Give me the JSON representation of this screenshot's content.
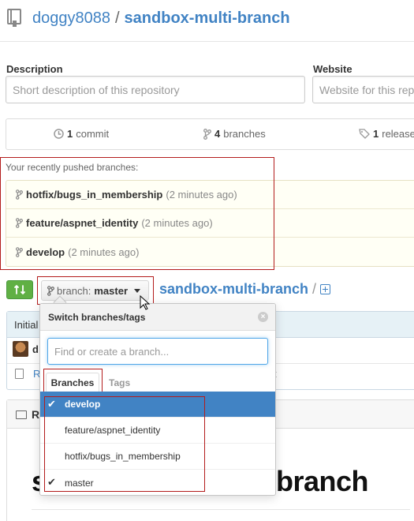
{
  "header": {
    "owner": "doggy8088",
    "separator": "/",
    "repo": "sandbox-multi-branch"
  },
  "form": {
    "description_label": "Description",
    "description_placeholder": "Short description of this repository",
    "website_label": "Website",
    "website_placeholder": "Website for this rep"
  },
  "stats": {
    "commits_count": "1",
    "commits_label": "commit",
    "branches_count": "4",
    "branches_label": "branches",
    "releases_count": "1",
    "releases_label": "release"
  },
  "recent": {
    "title": "Your recently pushed branches:",
    "items": [
      {
        "name": "hotfix/bugs_in_membership",
        "ago": "(2 minutes ago)"
      },
      {
        "name": "feature/aspnet_identity",
        "ago": "(2 minutes ago)"
      },
      {
        "name": "develop",
        "ago": "(2 minutes ago)"
      }
    ]
  },
  "branch_bar": {
    "prefix": "branch:",
    "current": "master",
    "crumb_repo": "sandbox-multi-branch",
    "crumb_sep": "/"
  },
  "background": {
    "commit_text": "Initial",
    "author_abbr": "d",
    "footer_left": "R",
    "footer_right": "t",
    "readme_label": "R",
    "readme_heading_left": "s",
    "readme_heading_right": "branch"
  },
  "dropdown": {
    "title": "Switch branches/tags",
    "close": "×",
    "filter_placeholder": "Find or create a branch...",
    "tabs": {
      "branches": "Branches",
      "tags": "Tags"
    },
    "items": [
      {
        "label": "develop",
        "checked": true,
        "selected": true
      },
      {
        "label": "feature/aspnet_identity",
        "checked": false,
        "selected": false
      },
      {
        "label": "hotfix/bugs_in_membership",
        "checked": false,
        "selected": false
      },
      {
        "label": "master",
        "checked": true,
        "selected": false
      }
    ],
    "check_glyph": "✔"
  },
  "colors": {
    "link": "#4183c4",
    "highlight_border": "#b31c1c",
    "selected_row": "#4183c4",
    "compare_button": "#60b044"
  }
}
